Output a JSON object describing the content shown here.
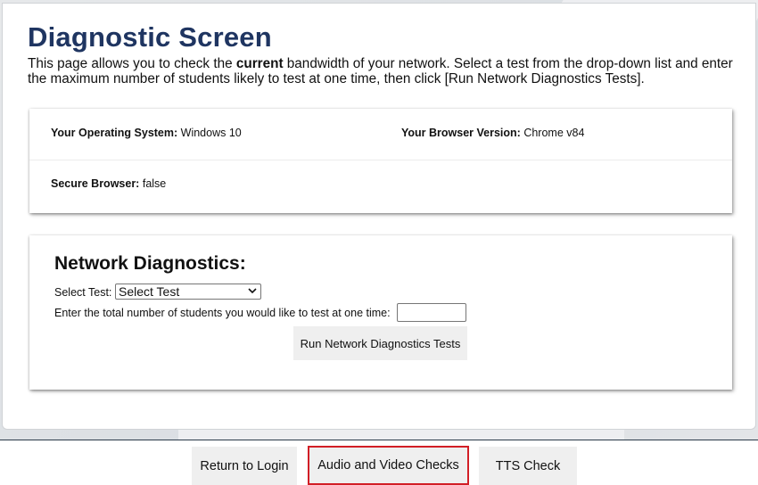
{
  "page": {
    "title": "Diagnostic Screen",
    "intro_before": "This page allows you to check the ",
    "intro_bold": "current",
    "intro_after": " bandwidth of your network. Select a test from the drop-down list and enter the maximum number of students likely to test at one time, then click [Run Network Diagnostics Tests]."
  },
  "system_info": {
    "os_label": "Your Operating System:",
    "os_value": "Windows 10",
    "browser_label": "Your Browser Version:",
    "browser_value": "Chrome v84",
    "secure_label": "Secure Browser:",
    "secure_value": "false"
  },
  "network": {
    "title": "Network Diagnostics:",
    "select_label": "Select Test:",
    "select_value": "Select Test",
    "students_label": "Enter the total number of students you would like to test at one time:",
    "students_value": "",
    "run_button": "Run Network Diagnostics Tests"
  },
  "footer": {
    "return_button": "Return to Login",
    "av_button": "Audio and Video Checks",
    "tts_button": "TTS Check"
  },
  "colors": {
    "title": "#1f3561",
    "highlight_border": "#d21e26",
    "button_bg": "#efefef"
  },
  "icons": {
    "select_chevron": "chevron-down-icon"
  }
}
